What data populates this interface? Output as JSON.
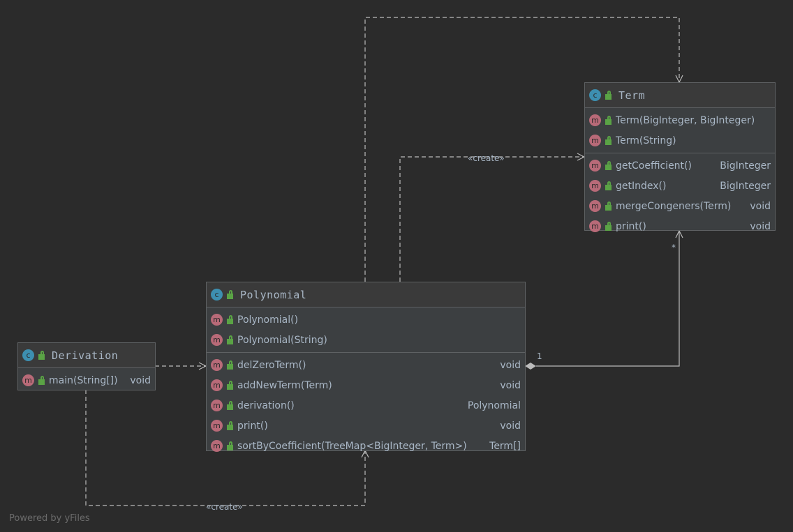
{
  "classes": {
    "term": {
      "name": "Term",
      "constructors": [
        {
          "sig": "Term(BigInteger, BigInteger)",
          "ret": ""
        },
        {
          "sig": "Term(String)",
          "ret": ""
        }
      ],
      "methods": [
        {
          "sig": "getCoefficient()",
          "ret": "BigInteger"
        },
        {
          "sig": "getIndex()",
          "ret": "BigInteger"
        },
        {
          "sig": "mergeCongeners(Term)",
          "ret": "void"
        },
        {
          "sig": "print()",
          "ret": "void"
        }
      ]
    },
    "polynomial": {
      "name": "Polynomial",
      "constructors": [
        {
          "sig": "Polynomial()",
          "ret": ""
        },
        {
          "sig": "Polynomial(String)",
          "ret": ""
        }
      ],
      "methods": [
        {
          "sig": "delZeroTerm()",
          "ret": "void"
        },
        {
          "sig": "addNewTerm(Term)",
          "ret": "void"
        },
        {
          "sig": "derivation()",
          "ret": "Polynomial"
        },
        {
          "sig": "print()",
          "ret": "void"
        },
        {
          "sig": "sortByCoefficient(TreeMap<BigInteger, Term>)",
          "ret": "Term[]"
        }
      ]
    },
    "derivation": {
      "name": "Derivation",
      "methods": [
        {
          "sig": "main(String[])",
          "ret": "void"
        }
      ]
    }
  },
  "icons": {
    "class": "c",
    "method": "m"
  },
  "edges": {
    "create_label": "«create»",
    "mult_one": "1",
    "mult_many": "*"
  },
  "footer": "Powered by yFiles"
}
